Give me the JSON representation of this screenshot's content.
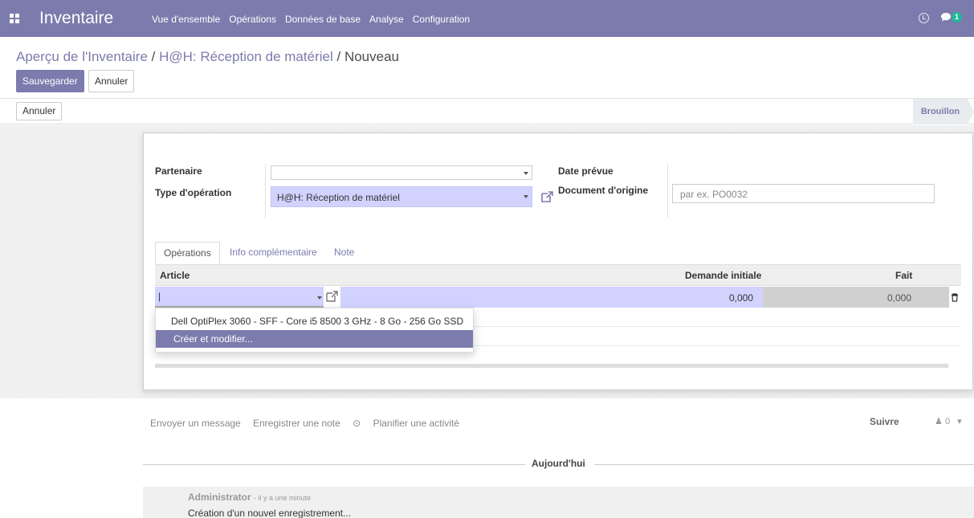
{
  "navbar": {
    "app_name": "Inventaire",
    "menu": [
      "Vue d'ensemble",
      "Opérations",
      "Données de base",
      "Analyse",
      "Configuration"
    ],
    "chat_badge": "1"
  },
  "breadcrumb": {
    "parent1": "Aperçu de l'Inventaire",
    "sep": "/",
    "parent2": "H@H: Réception de matériel",
    "current": "Nouveau"
  },
  "actions": {
    "save": "Sauvegarder",
    "discard": "Annuler"
  },
  "statusbar": {
    "cancel": "Annuler",
    "stage": "Brouillon"
  },
  "form": {
    "partner_label": "Partenaire",
    "partner_value": "",
    "op_type_label": "Type d'opération",
    "op_type_value": "H@H: Réception de matériel",
    "scheduled_label": "Date prévue",
    "origin_label": "Document d'origine",
    "origin_placeholder": "par ex. PO0032"
  },
  "tabs": [
    "Opérations",
    "Info complémentaire",
    "Note"
  ],
  "table": {
    "headers": {
      "article": "Article",
      "demand": "Demande initiale",
      "done": "Fait"
    },
    "edit_row": {
      "article": "|",
      "demand": "0,000",
      "done": "0,000"
    }
  },
  "dropdown": {
    "items": [
      "Dell OptiPlex 3060 - SFF - Core i5 8500 3 GHz - 8 Go - 256 Go SSD",
      "Créer et modifier..."
    ]
  },
  "chatter": {
    "send_message": "Envoyer un message",
    "log_note": "Enregistrer une note",
    "schedule_activity": "Planifier une activité",
    "follow": "Suivre",
    "followers_count": "0",
    "day": "Aujourd'hui",
    "message": {
      "author": "Administrator",
      "date": "- il y a une minute",
      "body": "Création d'un nouvel enregistrement..."
    }
  },
  "colors": {
    "brand": "#7c7bad",
    "required": "#d2d2ff"
  }
}
